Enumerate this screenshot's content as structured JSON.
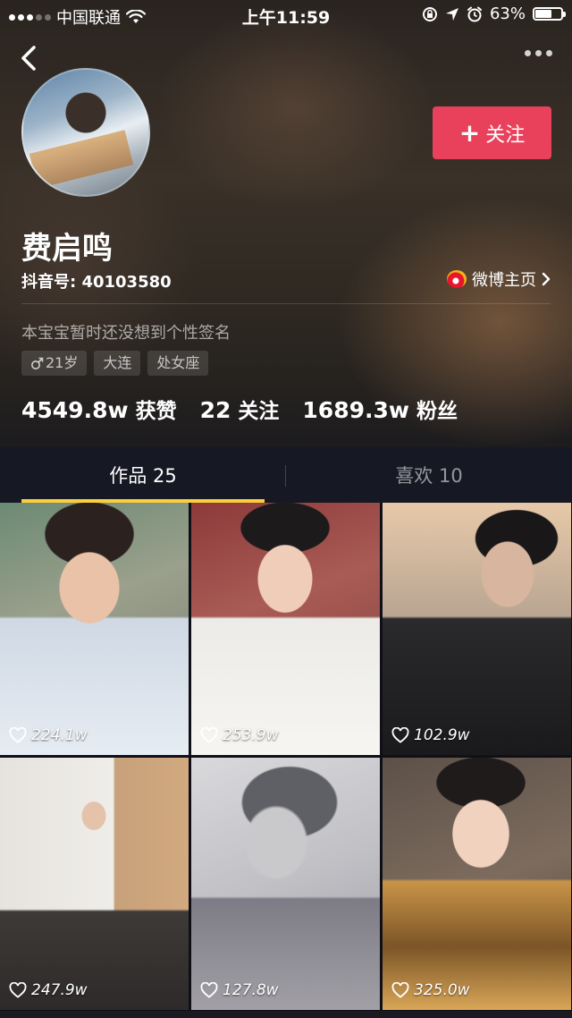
{
  "status_bar": {
    "carrier": "中国联通",
    "time": "上午11:59",
    "battery": "63%",
    "battery_level": 0.63
  },
  "profile": {
    "name": "费启鸣",
    "douyin_id": "抖音号: 40103580",
    "weibo_label": "微博主页",
    "signature": "本宝宝暂时还没想到个性签名",
    "follow_label": "关注",
    "tags": [
      "21岁",
      "大连",
      "处女座"
    ],
    "stats": {
      "likes_num": "4549.8w",
      "likes_label": "获赞",
      "following_num": "22",
      "following_label": "关注",
      "fans_num": "1689.3w",
      "fans_label": "粉丝"
    }
  },
  "tabs": {
    "works": "作品 25",
    "likes": "喜欢 10",
    "active": "works"
  },
  "videos": [
    {
      "likes": "224.1w"
    },
    {
      "likes": "253.9w"
    },
    {
      "likes": "102.9w"
    },
    {
      "likes": "247.9w"
    },
    {
      "likes": "127.8w"
    },
    {
      "likes": "325.0w"
    }
  ],
  "colors": {
    "follow_button": "#e9415b",
    "tab_indicator": "#fbce3e",
    "tab_bar": "#161823"
  },
  "icons": [
    "back-icon",
    "more-icon",
    "wifi-icon",
    "location-icon",
    "alarm-icon",
    "lock-rotation-icon",
    "weibo-icon",
    "male-icon",
    "heart-icon",
    "plus-icon"
  ]
}
